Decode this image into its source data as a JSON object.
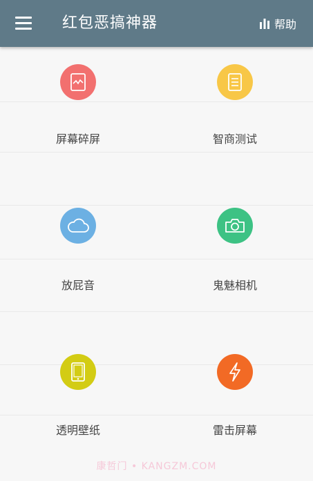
{
  "appbar": {
    "title": "红包恶搞神器",
    "help_label": "帮助",
    "menu_icon": "hamburger-menu-icon",
    "help_icon": "bar-chart-icon",
    "background": "#5f7a88"
  },
  "tiles": [
    {
      "label": "屏幕碎屏",
      "icon": "broken-screen-icon",
      "color": "#f2706f"
    },
    {
      "label": "智商测试",
      "icon": "document-icon",
      "color": "#f8c747"
    },
    {
      "label": "放屁音",
      "icon": "cloud-icon",
      "color": "#6cb0e3"
    },
    {
      "label": "鬼魅相机",
      "icon": "camera-icon",
      "color": "#3dc284"
    },
    {
      "label": "透明壁纸",
      "icon": "tablet-icon",
      "color": "#d3cc14"
    },
    {
      "label": "雷击屏幕",
      "icon": "lightning-icon",
      "color": "#f26a25"
    }
  ],
  "watermark": "康哲门 • KANGZM.COM"
}
